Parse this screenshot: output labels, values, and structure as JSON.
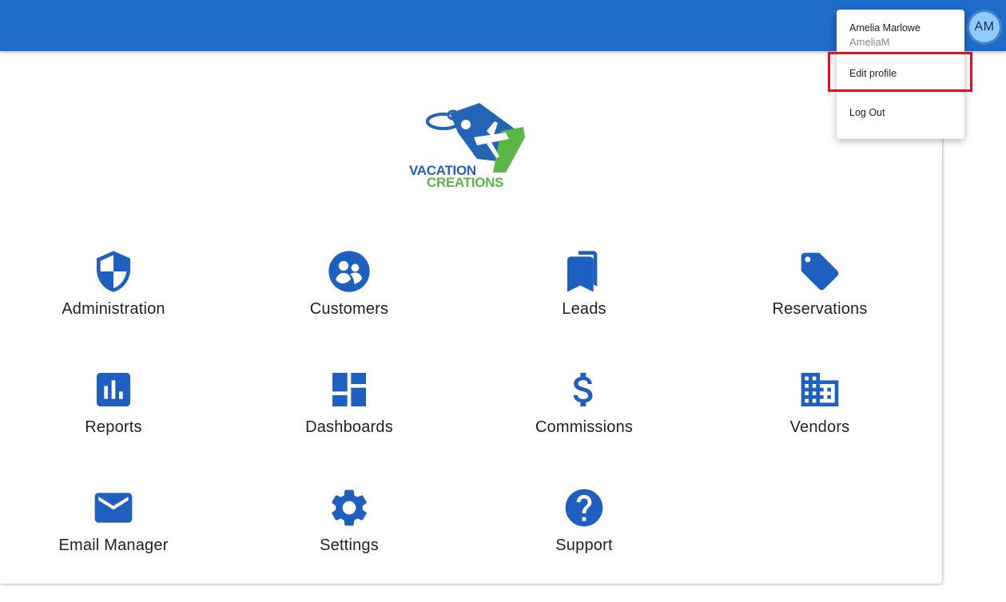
{
  "header": {
    "avatar_initials": "AM",
    "bar_color": "#1f6bc8"
  },
  "user_menu": {
    "name": "Amelia Marlowe",
    "login": "AmeliaM",
    "items": [
      {
        "label": "Edit profile",
        "highlighted": true
      },
      {
        "label": "Log Out"
      }
    ]
  },
  "logo": {
    "line1": "VACATION",
    "line2": "CREATIONS",
    "primary_color": "#2563b4",
    "accent_color": "#5cb547"
  },
  "tiles": [
    {
      "label": "Administration",
      "icon": "shield-icon"
    },
    {
      "label": "Customers",
      "icon": "people-circle-icon"
    },
    {
      "label": "Leads",
      "icon": "bookmarks-icon"
    },
    {
      "label": "Reservations",
      "icon": "tag-icon"
    },
    {
      "label": "Reports",
      "icon": "bar-chart-icon"
    },
    {
      "label": "Dashboards",
      "icon": "dashboard-icon"
    },
    {
      "label": "Commissions",
      "icon": "dollar-icon"
    },
    {
      "label": "Vendors",
      "icon": "building-icon"
    },
    {
      "label": "Email Manager",
      "icon": "email-icon"
    },
    {
      "label": "Settings",
      "icon": "gear-icon"
    },
    {
      "label": "Support",
      "icon": "help-icon"
    }
  ],
  "icon_color": "#1f5fbf"
}
